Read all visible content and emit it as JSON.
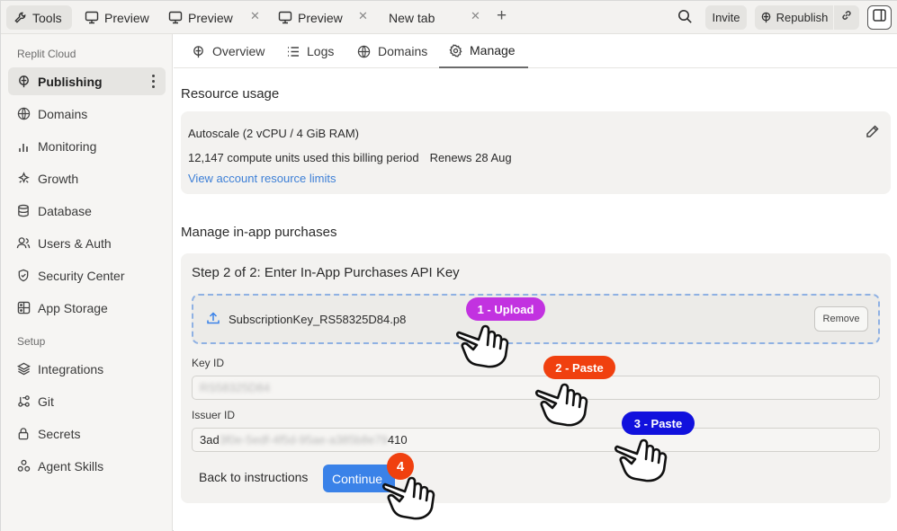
{
  "topbar": {
    "tools_label": "Tools",
    "tabs": [
      {
        "label": "Preview"
      },
      {
        "label": "Preview"
      },
      {
        "label": "Preview"
      },
      {
        "label": "New tab"
      }
    ],
    "invite_label": "Invite",
    "republish_label": "Republish"
  },
  "sidebar": {
    "section_cloud": "Replit Cloud",
    "section_setup": "Setup",
    "items": [
      {
        "label": "Publishing",
        "icon": "publish-icon",
        "active": true
      },
      {
        "label": "Domains",
        "icon": "globe-icon"
      },
      {
        "label": "Monitoring",
        "icon": "bar-chart-icon"
      },
      {
        "label": "Growth",
        "icon": "growth-icon"
      },
      {
        "label": "Database",
        "icon": "database-icon"
      },
      {
        "label": "Users & Auth",
        "icon": "users-icon"
      },
      {
        "label": "Security Center",
        "icon": "shield-icon"
      },
      {
        "label": "App Storage",
        "icon": "storage-icon"
      },
      {
        "label": "Integrations",
        "icon": "layers-icon"
      },
      {
        "label": "Git",
        "icon": "git-icon"
      },
      {
        "label": "Secrets",
        "icon": "lock-icon"
      },
      {
        "label": "Agent Skills",
        "icon": "skills-icon"
      }
    ]
  },
  "content_tabs": [
    {
      "label": "Overview",
      "icon": "publish-icon"
    },
    {
      "label": "Logs",
      "icon": "list-icon"
    },
    {
      "label": "Domains",
      "icon": "globe-icon"
    },
    {
      "label": "Manage",
      "icon": "gear-icon",
      "active": true
    }
  ],
  "resource": {
    "title": "Resource usage",
    "plan": "Autoscale (2 vCPU / 4 GiB RAM)",
    "usage": "12,147 compute units used this billing period",
    "renews": "Renews 28 Aug",
    "link": "View account resource limits"
  },
  "iap": {
    "title": "Manage in-app purchases",
    "step_title": "Step 2 of 2: Enter In-App Purchases API Key",
    "file_name": "SubscriptionKey_RS58325D84.p8",
    "remove_label": "Remove",
    "key_id_label": "Key ID",
    "key_id_value": "RS58325D84",
    "issuer_id_label": "Issuer ID",
    "issuer_prefix": "3ad",
    "issuer_hidden": "3f0e-5edf-4f5d-95ae-a385b8e79",
    "issuer_suffix": "410",
    "back_label": "Back to instructions",
    "continue_label": "Continue"
  },
  "annotations": {
    "step1": "1 - Upload",
    "step2": "2 - Paste",
    "step3": "3 - Paste",
    "step4": "4",
    "colors": {
      "step1": "#c232e0",
      "step2": "#f0400f",
      "step3": "#1111dd",
      "step4": "#f0400f"
    }
  },
  "colors": {
    "accent": "#3a82e8",
    "link": "#3d7fd6"
  }
}
